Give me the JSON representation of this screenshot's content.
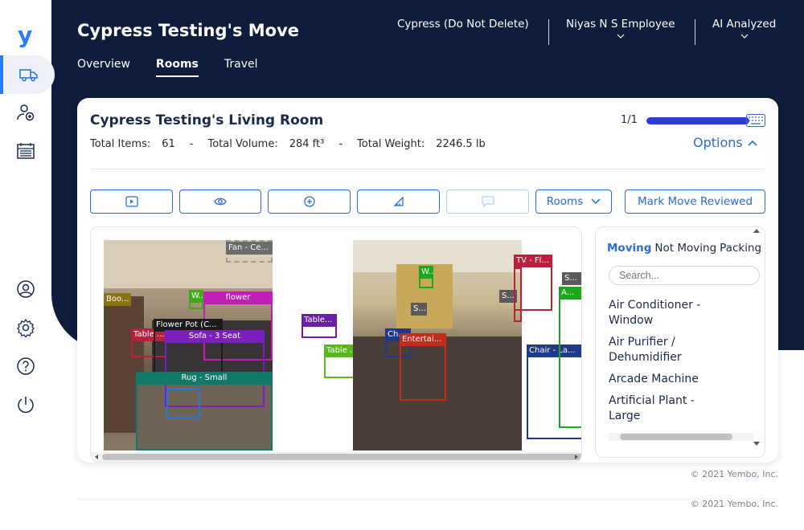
{
  "app": {
    "title": "Cypress Testing's Move"
  },
  "tabs": [
    {
      "label": "Overview"
    },
    {
      "label": "Rooms"
    },
    {
      "label": "Travel"
    }
  ],
  "header": {
    "company": "Cypress (Do Not Delete)",
    "user": "Niyas N S Employee",
    "mode": "AI Analyzed"
  },
  "room": {
    "title": "Cypress Testing's Living Room",
    "total_items_label": "Total Items:",
    "total_items": "61",
    "total_volume_label": "Total Volume:",
    "total_volume": "284 ft³",
    "total_weight_label": "Total Weight:",
    "total_weight": "2246.5 lb",
    "pager": "1/1",
    "progress_fraction": 1,
    "options_label": "Options"
  },
  "toolbar": {
    "rooms_label": "Rooms",
    "review_label": "Mark Move Reviewed"
  },
  "labels": {
    "fan": "Fan - Ce...",
    "boo": "Boo...",
    "w1": "W...",
    "flower": "flower",
    "table1": "Table ...",
    "flowerpot": "Flower Pot (C...",
    "sofa": "Sofa - 3 Seat",
    "rug": "Rug - Small",
    "table2": "Table...",
    "table3": "Table ...",
    "w2": "W...",
    "s1": "S...",
    "ch": "Ch...",
    "ent": "Entertai...",
    "s2": "S...",
    "tv": "TV - Fl...",
    "chair": "Chair - La...",
    "a": "A...",
    "s3": "S..."
  },
  "items_panel": {
    "tabs": [
      "Moving",
      "Not Moving",
      "Packing"
    ],
    "search_placeholder": "Search...",
    "items": [
      "Air Conditioner - Window",
      "Air Purifier / Dehumidifier",
      "Arcade Machine",
      "Artificial Plant - Large"
    ]
  },
  "footer": {
    "copyright": "© 2021 Yembo, Inc."
  },
  "colors": {
    "accent": "#2b6cd8",
    "navy": "#0f1d3d",
    "progress": "#2e3cd8"
  }
}
